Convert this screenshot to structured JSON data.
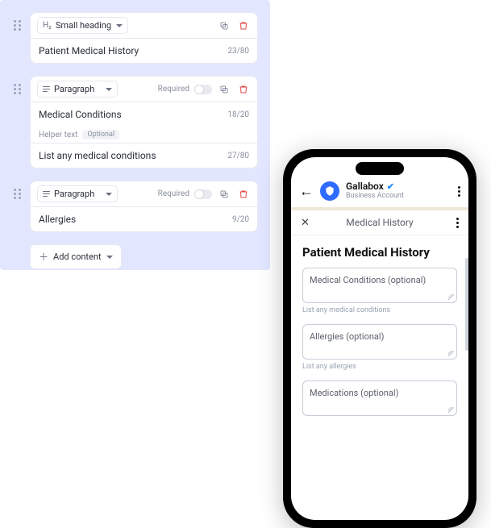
{
  "builder": {
    "blocks": [
      {
        "type_icon": "h2",
        "type_label": "Small heading",
        "value": "Patient Medical History",
        "count": "23/80",
        "hasRequiredToggle": false
      },
      {
        "type_icon": "para",
        "type_label": "Paragraph",
        "required_label": "Required",
        "value": "Medical Conditions",
        "count": "18/20",
        "helper_label": "Helper text",
        "helper_badge": "Optional",
        "helper_value": "List any medical conditions",
        "helper_count": "27/80",
        "hasRequiredToggle": true
      },
      {
        "type_icon": "para",
        "type_label": "Paragraph",
        "required_label": "Required",
        "value": "Allergies",
        "count": "9/20",
        "hasRequiredToggle": true
      }
    ],
    "add_label": "Add content"
  },
  "phone": {
    "brand": "Gallabox",
    "account_type": "Business Account",
    "sheet_title": "Medical History",
    "form_title": "Patient Medical History",
    "fields": [
      {
        "placeholder": "Medical Conditions (optional)",
        "hint": "List any medical conditions"
      },
      {
        "placeholder": "Allergies (optional)",
        "hint": "List any allergies"
      },
      {
        "placeholder": "Medications (optional)",
        "hint": ""
      }
    ]
  }
}
